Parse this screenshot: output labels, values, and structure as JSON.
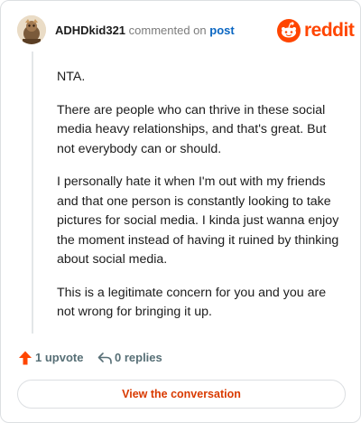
{
  "header": {
    "username": "ADHDkid321",
    "action_text": " commented on ",
    "post_link": "post",
    "brand_word": "reddit"
  },
  "comment": {
    "paragraphs": [
      "NTA.",
      "There are people who can thrive in these social media heavy relationships, and that's great. But not everybody can or should.",
      "I personally hate it when I'm out with my friends and that one person is constantly looking to take pictures for social media. I kinda just wanna enjoy the moment instead of having it ruined by thinking about social media.",
      "This is a legitimate concern for you and you are not wrong for bringing it up."
    ]
  },
  "actions": {
    "upvote_label": "1 upvote",
    "replies_label": "0 replies"
  },
  "cta": {
    "label": "View the conversation"
  },
  "colors": {
    "brand": "#ff4500",
    "link": "#0a66c2",
    "cta_text": "#d93a00",
    "muted": "#576f76"
  }
}
